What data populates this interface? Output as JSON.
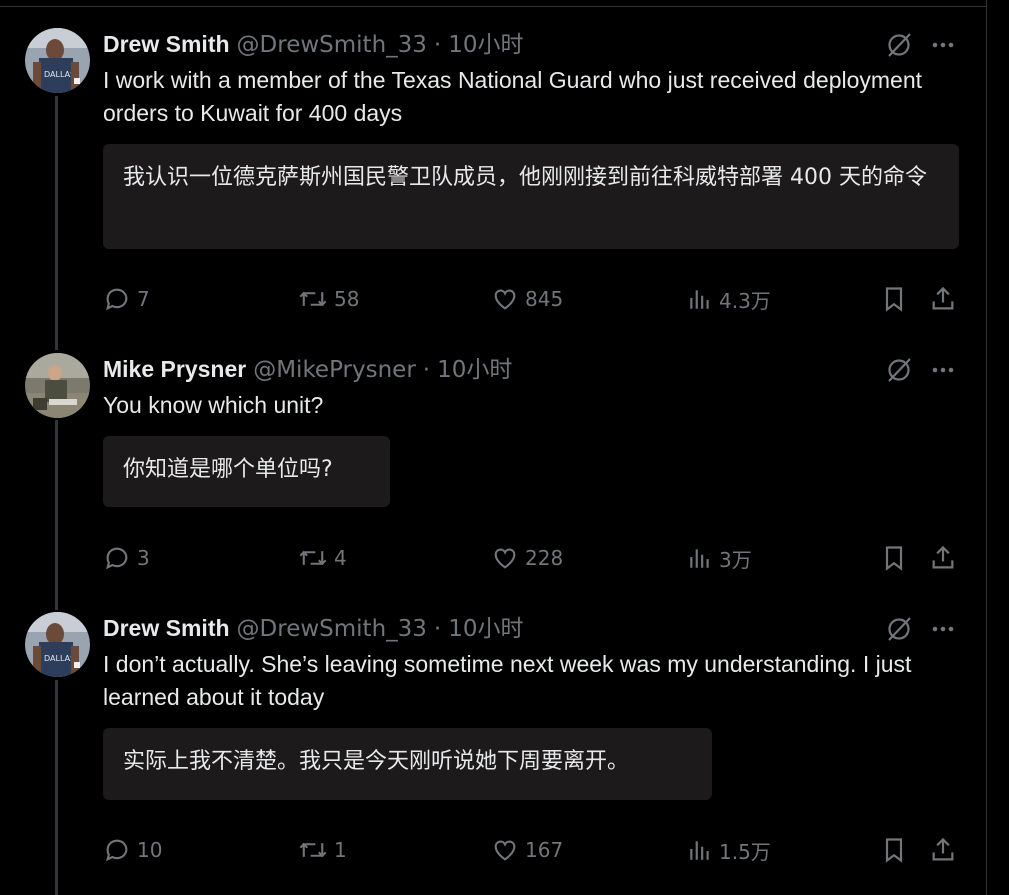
{
  "colors": {
    "background": "#000000",
    "text_primary": "#e7e9ea",
    "text_secondary": "#71767b",
    "translation_bg": "#1c1a1b",
    "thread_line": "#333639"
  },
  "tweets": [
    {
      "display_name": "Drew Smith",
      "handle": "@DrewSmith_33",
      "separator": "·",
      "time": "10小时",
      "text": "I work with a member of the Texas National Guard who just received deployment orders to Kuwait for 400 days",
      "translation": "我认识一位德克萨斯州国民警卫队成员，他刚刚接到前往科威特部署 400 天的命令",
      "replies": "7",
      "retweets": "58",
      "likes": "845",
      "views": "4.3万",
      "icons": [
        "avatar",
        "grok-icon",
        "more-icon",
        "reply-icon",
        "retweet-icon",
        "like-icon",
        "views-icon",
        "bookmark-icon",
        "share-icon"
      ]
    },
    {
      "display_name": "Mike Prysner",
      "handle": "@MikePrysner",
      "separator": "·",
      "time": "10小时",
      "text": "You know which unit?",
      "translation": "你知道是哪个单位吗?",
      "replies": "3",
      "retweets": "4",
      "likes": "228",
      "views": "3万",
      "icons": [
        "avatar",
        "grok-icon",
        "more-icon",
        "reply-icon",
        "retweet-icon",
        "like-icon",
        "views-icon",
        "bookmark-icon",
        "share-icon"
      ]
    },
    {
      "display_name": "Drew Smith",
      "handle": "@DrewSmith_33",
      "separator": "·",
      "time": "10小时",
      "text": "I don’t actually. She’s leaving sometime next week was my understanding. I just learned about it today",
      "translation": "实际上我不清楚。我只是今天刚听说她下周要离开。",
      "replies": "10",
      "retweets": "1",
      "likes": "167",
      "views": "1.5万",
      "icons": [
        "avatar",
        "grok-icon",
        "more-icon",
        "reply-icon",
        "retweet-icon",
        "like-icon",
        "views-icon",
        "bookmark-icon",
        "share-icon"
      ]
    }
  ]
}
